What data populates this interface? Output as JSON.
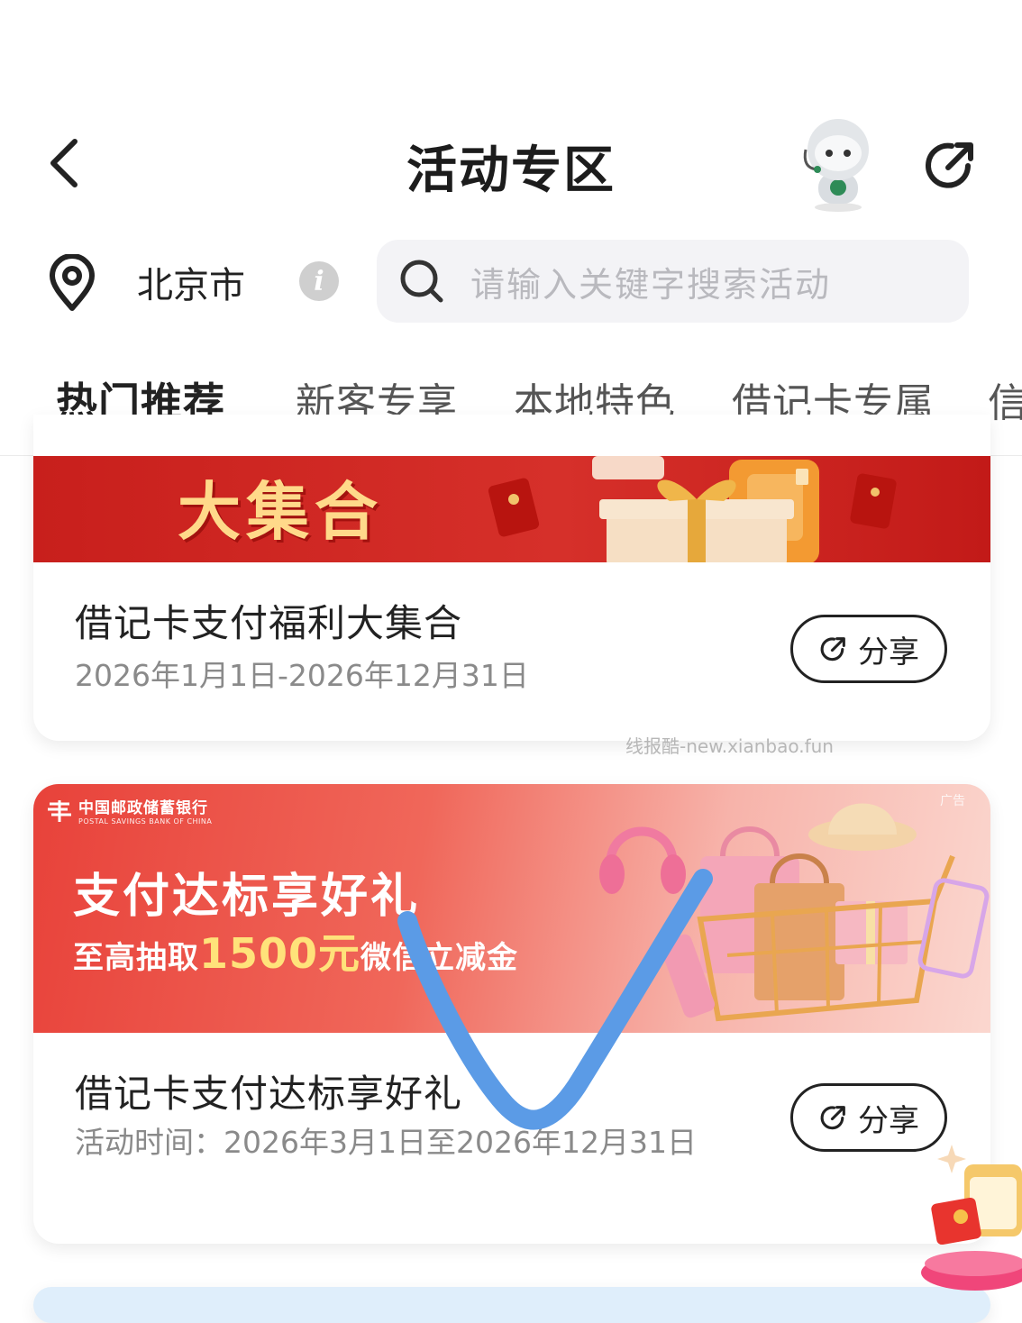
{
  "header": {
    "title": "活动专区",
    "back_icon": "chevron-left-icon",
    "assistant_icon": "robot-assistant-icon",
    "share_icon": "share-icon"
  },
  "location": {
    "city": "北京市",
    "icon": "location-pin-icon",
    "info_icon": "info-icon"
  },
  "search": {
    "placeholder": "请输入关键字搜索活动",
    "icon": "search-icon"
  },
  "tabs": [
    {
      "label": "热门推荐",
      "active": true
    },
    {
      "label": "新客专享",
      "active": false
    },
    {
      "label": "本地特色",
      "active": false
    },
    {
      "label": "借记卡专属",
      "active": false
    },
    {
      "label": "信",
      "active": false
    }
  ],
  "accent_color": "#1f6b3d",
  "cards": [
    {
      "banner_text": "大集合",
      "title": "借记卡支付福利大集合",
      "date": "2026年1月1日-2026年12月31日",
      "share_label": "分享",
      "banner_color": "#c81f1c"
    },
    {
      "bank_name": "中国邮政储蓄银行",
      "bank_name_en": "POSTAL SAVINGS BANK OF CHINA",
      "ad_tag": "广告",
      "banner_heading": "支付达标享好礼",
      "banner_sub_prefix": "至高抽取",
      "banner_sub_amount": "1500元",
      "banner_sub_suffix": "微信立减金",
      "title": "借记卡支付达标享好礼",
      "date": "活动时间：2026年3月1日至2026年12月31日",
      "share_label": "分享",
      "banner_color": "#e8423a"
    }
  ],
  "watermark": "线报酷-new.xianbao.fun"
}
